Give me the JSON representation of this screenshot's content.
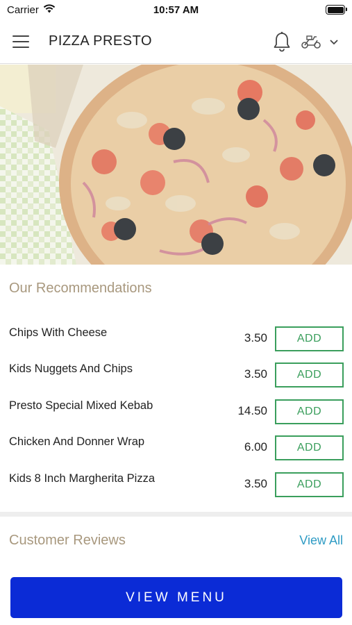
{
  "status_bar": {
    "carrier": "Carrier",
    "time": "10:57 AM"
  },
  "header": {
    "title": "PIZZA PRESTO",
    "menu_icon": "hamburger-icon",
    "notification_icon": "bell-icon",
    "delivery_icon": "scooter-icon",
    "dropdown_icon": "chevron-down-icon"
  },
  "hero": {
    "image": "pizza-photo"
  },
  "recommendations": {
    "title": "Our Recommendations",
    "add_label": "ADD",
    "items": [
      {
        "name": "Chips With Cheese",
        "price": "3.50"
      },
      {
        "name": "Kids Nuggets And Chips",
        "price": "3.50"
      },
      {
        "name": "Presto Special Mixed Kebab",
        "price": "14.50"
      },
      {
        "name": "Chicken And Donner Wrap",
        "price": "6.00"
      },
      {
        "name": "Kids 8 Inch Margherita Pizza",
        "price": "3.50"
      }
    ]
  },
  "reviews": {
    "title": "Customer Reviews",
    "view_all": "View All"
  },
  "footer": {
    "view_menu": "VIEW MENU"
  },
  "colors": {
    "accent": "#0b2bd6",
    "add_green": "#3a9e5c",
    "section_title": "#a8987e",
    "link": "#2e9bc4"
  }
}
